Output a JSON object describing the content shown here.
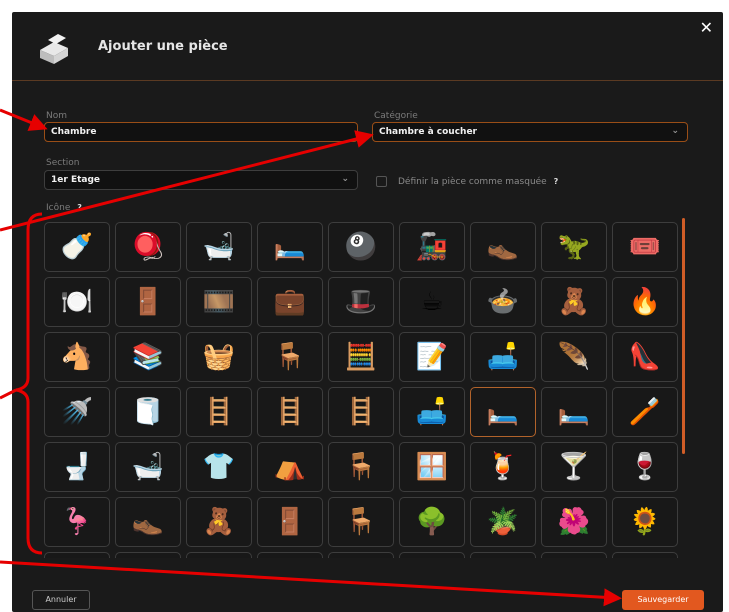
{
  "dialog": {
    "title": "Ajouter une pièce",
    "close_label": "✕"
  },
  "form": {
    "nom_label": "Nom",
    "nom_value": "Chambre",
    "categorie_label": "Catégorie",
    "categorie_value": "Chambre à coucher",
    "section_label": "Section",
    "section_value": "1er Etage",
    "hidden_label": "Définir la pièce comme masquée",
    "help_glyph": "?",
    "icone_label": "Icône"
  },
  "icons": [
    "🍼",
    "🪀",
    "🛁",
    "🛏️",
    "🎱",
    "🚂",
    "👞",
    "🦖",
    "🎟️",
    "🍽️",
    "🚪",
    "🎞️",
    "💼",
    "🎩",
    "☕",
    "🍲",
    "🧸",
    "🔥",
    "🐴",
    "📚",
    "🧺",
    "🪑",
    "🧮",
    "📝",
    "🛋️",
    "🪶",
    "👠",
    "🚿",
    "🧻",
    "🪜",
    "🪜",
    "🪜",
    "🛋️",
    "🛏️",
    "🛏️",
    "🪥",
    "🚽",
    "🛁",
    "👕",
    "⛺",
    "🪑",
    "🪟",
    "🍹",
    "🍸",
    "🍷",
    "🦩",
    "👞",
    "🧸",
    "🚪",
    "🪑",
    "🌳",
    "🪴",
    "🌺",
    "🌻"
  ],
  "selected_icon_index": 33,
  "footer": {
    "cancel_label": "Annuler",
    "save_label": "Sauvegarder"
  },
  "colors": {
    "accent": "#e2581f",
    "annotation": "#e60000",
    "background": "#1a1a1a"
  }
}
